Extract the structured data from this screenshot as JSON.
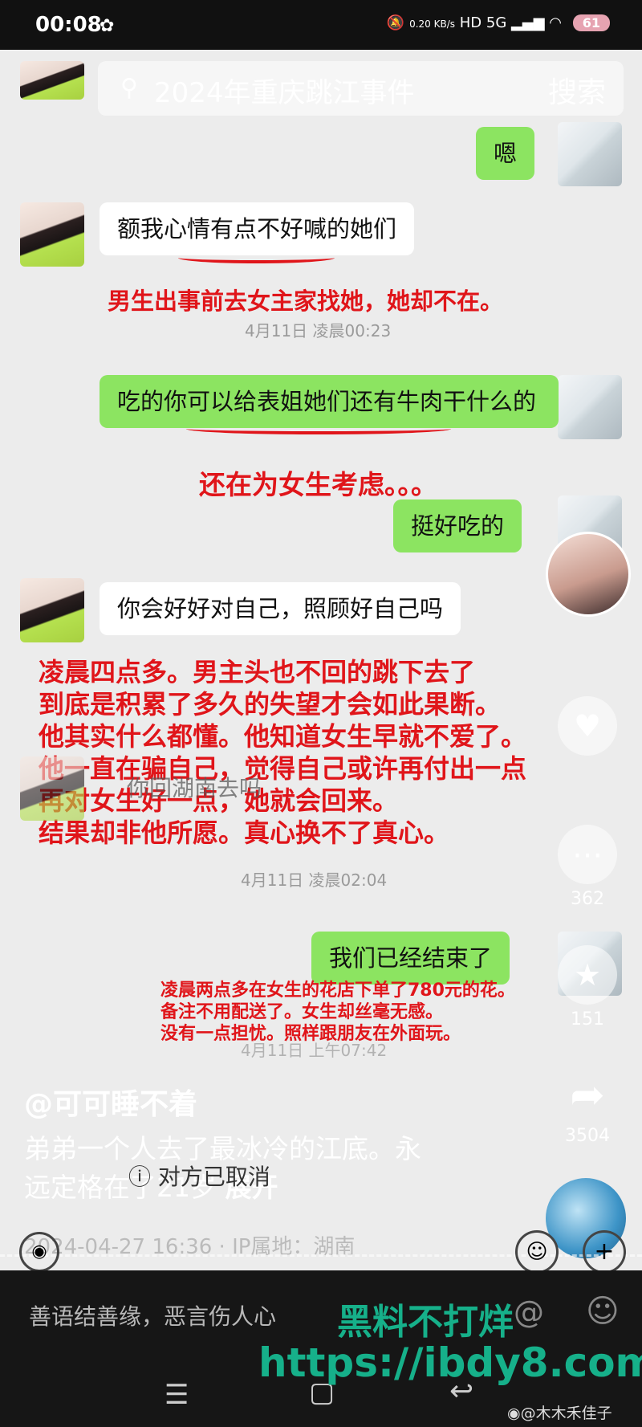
{
  "status_bar": {
    "time": "00:08",
    "speed": "0.20 KB/s",
    "network": "HD 5G",
    "battery": "61"
  },
  "search": {
    "placeholder": "2024年重庆跳江事件",
    "button": "搜索"
  },
  "messages": [
    {
      "text": "嗯",
      "side": "right"
    },
    {
      "text": "额我心情有点不好喊的她们",
      "side": "left"
    },
    {
      "text": "吃的你可以给表姐她们还有牛肉干什么的",
      "side": "right"
    },
    {
      "text": "挺好吃的",
      "side": "right"
    },
    {
      "text": "你会好好对自己，照顾好自己吗",
      "side": "left"
    },
    {
      "text": "你回湖南去吗",
      "side": "left"
    },
    {
      "text": "我们已经结束了",
      "side": "right"
    }
  ],
  "timestamps": [
    "4月11日 凌晨00:23",
    "4月11日 凌晨02:04",
    "4月11日 上午07:42"
  ],
  "annotations": {
    "a1": "男生出事前去女主家找她，她却不在。",
    "a2": "还在为女生考虑。。。",
    "a3": [
      "凌晨四点多。男主头也不回的跳下去了",
      "到底是积累了多久的失望才会如此果断。",
      "他其实什么都懂。他知道女生早就不爱了。",
      "他一直在骗自己，觉得自己或许再付出一点",
      "再对女生好一点，她就会回来。",
      "结果却非他所愿。真心换不了真心。"
    ],
    "a4": [
      "凌晨两点多在女生的花店下单了780元的花。",
      "备注不用配送了。女生却丝毫无感。",
      "没有一点担忧。照样跟朋友在外面玩。"
    ]
  },
  "withdraw": "对方已取消",
  "rail": {
    "likes": "",
    "comments": "362",
    "favorites": "151",
    "shares": "3504"
  },
  "post": {
    "author": "@可可睡不着",
    "caption": [
      "弟弟一个人去了最冰冷的江底。永",
      "远定格在了21岁"
    ],
    "expand": "展开",
    "meta": "2024-04-27 16:36 · IP属地：湖南"
  },
  "comment_bar": {
    "placeholder": "善语结善缘，恶言伤人心"
  },
  "watermark": {
    "line1": "黑料不打烊",
    "line2": "https://ibdy8.com",
    "weibo": "@木木禾佳子"
  }
}
